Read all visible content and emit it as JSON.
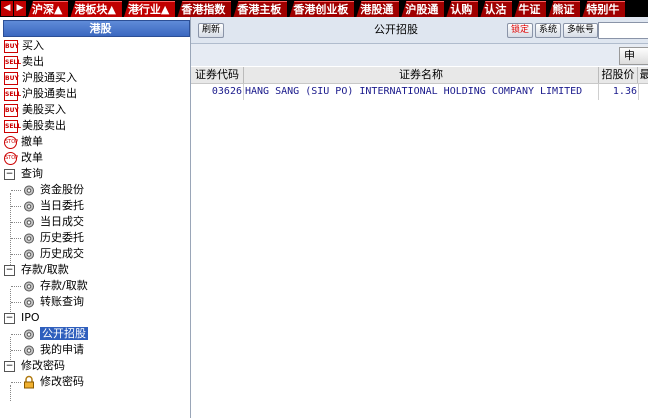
{
  "top_tabs": [
    "沪深▲",
    "港板块▲",
    "港行业▲",
    "香港指数",
    "香港主板",
    "香港创业板",
    "港股通",
    "沪股通",
    "认购",
    "认沽",
    "牛证",
    "熊证",
    "特别牛"
  ],
  "left_panel": {
    "title": "港股",
    "items": {
      "buy": "买入",
      "sell": "卖出",
      "hk_connect_buy": "沪股通买入",
      "hk_connect_sell": "沪股通卖出",
      "us_buy": "美股买入",
      "us_sell": "美股卖出",
      "cancel": "撤单",
      "amend": "改单",
      "query": "查询",
      "funds": "资金股份",
      "today_orders": "当日委托",
      "today_trades": "当日成交",
      "history_orders": "历史委托",
      "history_trades": "历史成交",
      "deposit_withdraw": "存款/取款",
      "deposit_withdraw_child": "存款/取款",
      "transfer_query": "转账查询",
      "ipo": "IPO",
      "public_offering": "公开招股",
      "my_application": "我的申请",
      "change_password": "修改密码",
      "change_password_child": "修改密码"
    },
    "icons": {
      "buy": "BUY",
      "sell": "SELL",
      "cancel": "STOP"
    }
  },
  "toolbar": {
    "refresh": "刷新",
    "title": "公开招股",
    "lock": "锁定",
    "system": "系统",
    "multi_account": "多帐号"
  },
  "apply_button": "申",
  "table": {
    "headers": {
      "code": "证券代码",
      "name": "证券名称",
      "price": "招股价",
      "more": "最"
    },
    "rows": [
      {
        "code": "03626",
        "name": "HANG SANG (SIU PO) INTERNATIONAL HOLDING COMPANY LIMITED",
        "price": "1.36"
      }
    ]
  },
  "colors": {
    "tab_red": "#c00000",
    "selection_blue": "#2f5fbd",
    "grid_text": "#1a1a8c"
  }
}
